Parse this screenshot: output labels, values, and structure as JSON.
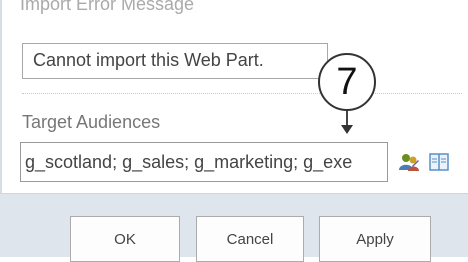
{
  "import_error": {
    "title": "Import Error Message",
    "message": "Cannot import this Web Part."
  },
  "target_audiences": {
    "title": "Target Audiences",
    "value": "g_scotland; g_sales; g_marketing; g_exe"
  },
  "callout": {
    "number": "7"
  },
  "icons": {
    "people_picker": "people-picker-icon",
    "browse": "address-book-icon"
  },
  "buttons": {
    "ok": "OK",
    "cancel": "Cancel",
    "apply": "Apply"
  },
  "colors": {
    "footer_bg": "#dfe5ed",
    "text": "#444444",
    "border": "#a8a8a8"
  }
}
